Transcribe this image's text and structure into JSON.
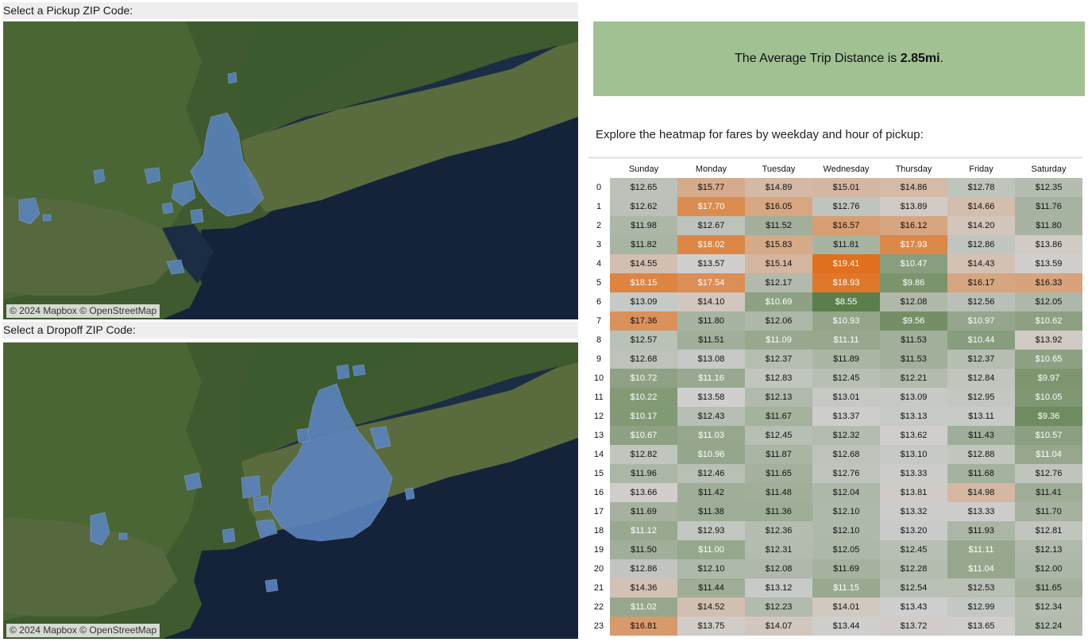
{
  "pickup_map": {
    "label": "Select a Pickup ZIP Code:",
    "attribution": "© 2024 Mapbox © OpenStreetMap"
  },
  "dropoff_map": {
    "label": "Select a Dropoff ZIP Code:",
    "attribution": "© 2024 Mapbox © OpenStreetMap"
  },
  "kpi": {
    "prefix": "The Average Trip Distance is ",
    "value": "2.85mi",
    "suffix": "."
  },
  "heatmap": {
    "intro": "Explore the heatmap for fares by weekday and hour of pickup:",
    "days": [
      "Sunday",
      "Monday",
      "Tuesday",
      "Wednesday",
      "Thursday",
      "Friday",
      "Saturday"
    ],
    "hours": [
      "0",
      "1",
      "2",
      "3",
      "4",
      "5",
      "6",
      "7",
      "8",
      "9",
      "10",
      "11",
      "12",
      "13",
      "14",
      "15",
      "16",
      "17",
      "18",
      "19",
      "20",
      "21",
      "22",
      "23"
    ],
    "rows": [
      [
        "$12.65",
        "$15.77",
        "$14.89",
        "$15.01",
        "$14.86",
        "$12.78",
        "$12.35"
      ],
      [
        "$12.62",
        "$17.70",
        "$16.05",
        "$12.76",
        "$13.89",
        "$14.66",
        "$11.76"
      ],
      [
        "$11.98",
        "$12.67",
        "$11.52",
        "$16.57",
        "$16.12",
        "$14.20",
        "$11.80"
      ],
      [
        "$11.82",
        "$18.02",
        "$15.83",
        "$11.81",
        "$17.93",
        "$12.86",
        "$13.86"
      ],
      [
        "$14.55",
        "$13.57",
        "$15.14",
        "$19.41",
        "$10.47",
        "$14.43",
        "$13.59"
      ],
      [
        "$18.15",
        "$17.54",
        "$12.17",
        "$18.93",
        "$9.86",
        "$16.17",
        "$16.33"
      ],
      [
        "$13.09",
        "$14.10",
        "$10.69",
        "$8.55",
        "$12.08",
        "$12.56",
        "$12.05"
      ],
      [
        "$17.36",
        "$11.80",
        "$12.06",
        "$10.93",
        "$9.56",
        "$10.97",
        "$10.62"
      ],
      [
        "$12.57",
        "$11.51",
        "$11.09",
        "$11.11",
        "$11.53",
        "$10.44",
        "$13.92"
      ],
      [
        "$12.68",
        "$13.08",
        "$12.37",
        "$11.89",
        "$11.53",
        "$12.37",
        "$10.65"
      ],
      [
        "$10.72",
        "$11.16",
        "$12.83",
        "$12.45",
        "$12.21",
        "$12.84",
        "$9.97"
      ],
      [
        "$10.22",
        "$13.58",
        "$12.13",
        "$13.01",
        "$13.09",
        "$12.95",
        "$10.05"
      ],
      [
        "$10.17",
        "$12.43",
        "$11.67",
        "$13.37",
        "$13.13",
        "$13.11",
        "$9.36"
      ],
      [
        "$10.67",
        "$11.03",
        "$12.45",
        "$12.32",
        "$13.62",
        "$11.43",
        "$10.57"
      ],
      [
        "$12.82",
        "$10.96",
        "$11.87",
        "$12.68",
        "$13.10",
        "$12.88",
        "$11.04"
      ],
      [
        "$11.96",
        "$12.46",
        "$11.65",
        "$12.76",
        "$13.33",
        "$11.68",
        "$12.76"
      ],
      [
        "$13.66",
        "$11.42",
        "$11.48",
        "$12.04",
        "$13.81",
        "$14.98",
        "$11.41"
      ],
      [
        "$11.69",
        "$11.38",
        "$11.36",
        "$12.10",
        "$13.32",
        "$13.33",
        "$11.70"
      ],
      [
        "$11.12",
        "$12.93",
        "$12.36",
        "$12.10",
        "$13.20",
        "$11.93",
        "$12.81"
      ],
      [
        "$11.50",
        "$11.00",
        "$12.31",
        "$12.05",
        "$12.45",
        "$11.11",
        "$12.13"
      ],
      [
        "$12.86",
        "$12.10",
        "$12.08",
        "$11.69",
        "$12.28",
        "$11.04",
        "$12.00"
      ],
      [
        "$14.36",
        "$11.44",
        "$13.12",
        "$11.15",
        "$12.54",
        "$12.53",
        "$11.65"
      ],
      [
        "$11.02",
        "$14.52",
        "$12.23",
        "$14.01",
        "$13.43",
        "$12.99",
        "$12.34"
      ],
      [
        "$16.81",
        "$13.75",
        "$14.07",
        "$13.44",
        "$13.72",
        "$13.65",
        "$12.24"
      ]
    ],
    "color_scale": {
      "low": "#5c7e4a",
      "mid": "#d0d0d0",
      "high": "#e0701c",
      "low_value": 8.55,
      "mid_value": 13.5,
      "high_value": 19.41
    }
  }
}
